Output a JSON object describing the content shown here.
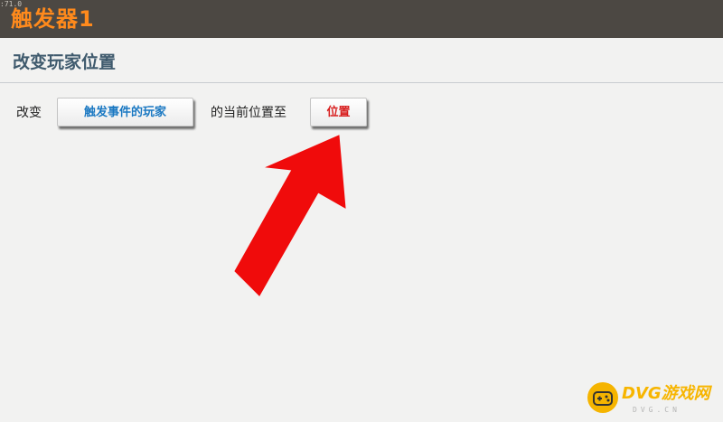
{
  "window": {
    "version": ":71.0",
    "title": "触发器1"
  },
  "section": {
    "title": "改变玩家位置"
  },
  "action": {
    "prefix": "改变",
    "target_button": "触发事件的玩家",
    "middle": "的当前位置至",
    "position_button": "位置"
  },
  "colors": {
    "titlebar": "#4c4843",
    "title_text": "#ff8a1c",
    "section_text": "#3f5a6d",
    "target_button_text": "#1a78c2",
    "position_button_text": "#d81f1f",
    "arrow": "#f00b0b"
  },
  "watermark": {
    "brand": "DVG游戏网",
    "domain": "DVG.CN",
    "icon": "gamepad-icon"
  }
}
